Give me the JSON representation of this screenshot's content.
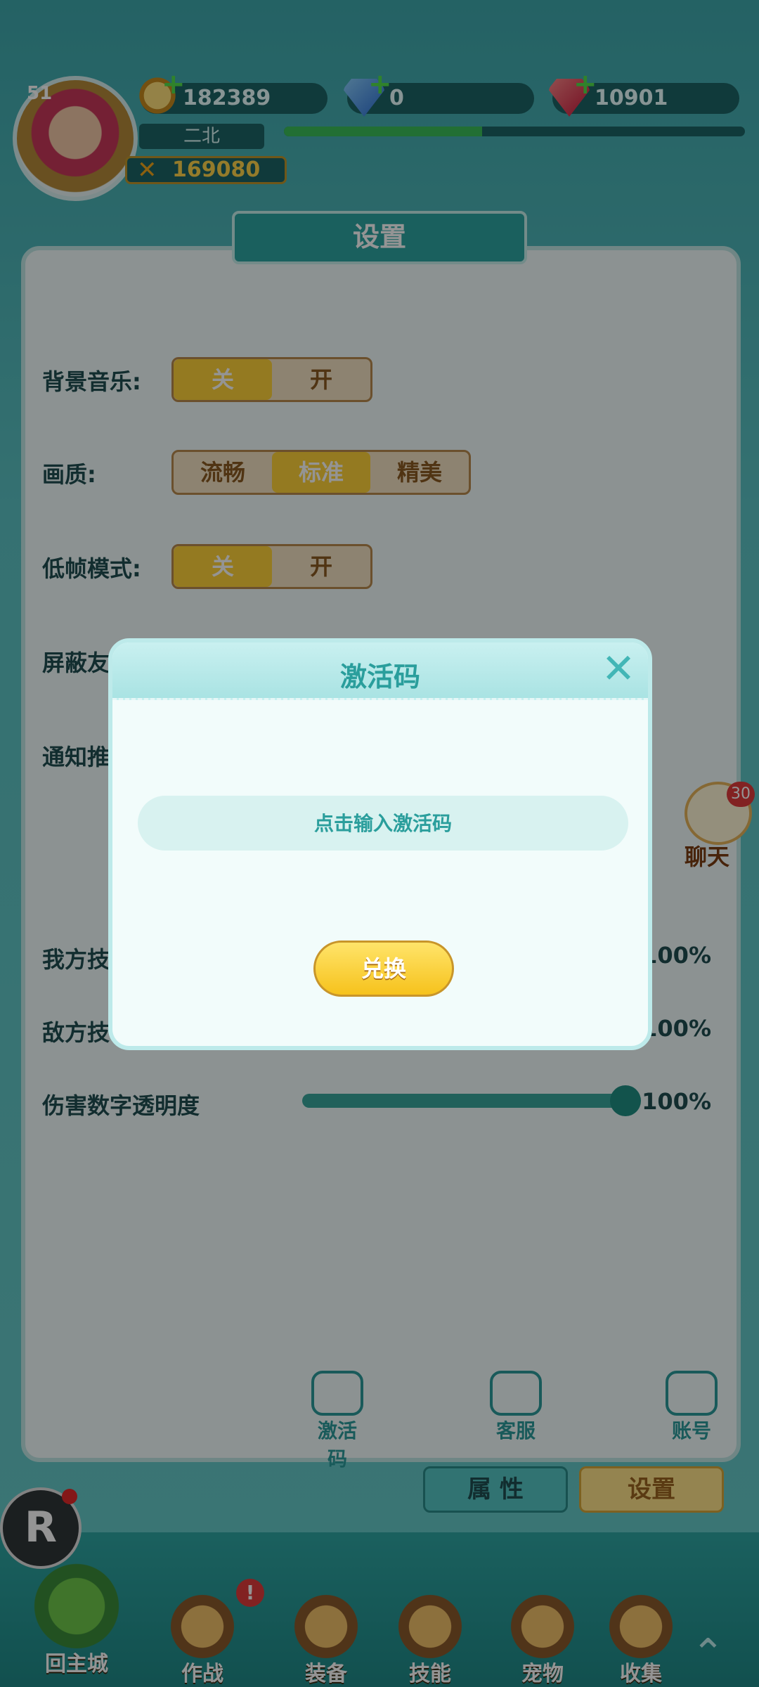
{
  "player": {
    "level": "51",
    "name": "二北",
    "power": "169080",
    "exp_fraction": 0.43
  },
  "resources": {
    "gold": "182389",
    "gems": "0",
    "rubies": "10901"
  },
  "panel": {
    "title": "设置",
    "rows": {
      "bg_music": {
        "label": "背景音乐:",
        "off": "关",
        "on": "开"
      },
      "quality": {
        "label": "画质:",
        "opt1": "流畅",
        "opt2": "标准",
        "opt3": "精美"
      },
      "low_fps": {
        "label": "低帧模式:",
        "off": "关",
        "on": "开"
      },
      "shield": {
        "label": "屏蔽友"
      },
      "notify": {
        "label": "通知推"
      }
    },
    "sliders": {
      "our_skill": {
        "label": "我方技",
        "value": "100%"
      },
      "enemy_skill": {
        "label": "敌方技",
        "value": "100%"
      },
      "damage_opacity": {
        "label": "伤害数字透明度",
        "value": "100%"
      }
    },
    "buttons": {
      "activation": "激活码",
      "service": "客服",
      "account": "账号"
    }
  },
  "tabs": {
    "attributes": "属 性",
    "settings": "设置"
  },
  "chat": {
    "badge": "30",
    "label": "聊天"
  },
  "nav": {
    "home": "回主城",
    "battle": "作战",
    "equipment": "装备",
    "skills": "技能",
    "pets": "宠物",
    "collection": "收集",
    "battle_badge": "!"
  },
  "floating": {
    "r_label": "R"
  },
  "modal": {
    "title": "激活码",
    "close_symbol": "✕",
    "input_placeholder": "点击输入激活码",
    "redeem_label": "兑换"
  }
}
